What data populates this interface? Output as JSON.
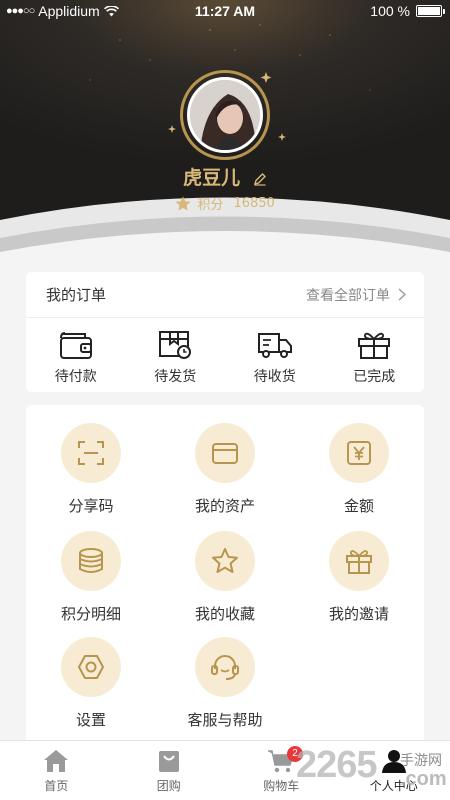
{
  "status_bar": {
    "carrier": "Applidium",
    "time": "11:27 AM",
    "battery": "100 %"
  },
  "profile": {
    "username": "虎豆儿",
    "points_label": "积分",
    "points_value": "16850"
  },
  "orders": {
    "title": "我的订单",
    "view_all": "查看全部订单",
    "items": [
      {
        "label": "待付款",
        "icon": "wallet-icon"
      },
      {
        "label": "待发货",
        "icon": "shipping-box-icon"
      },
      {
        "label": "待收货",
        "icon": "truck-icon"
      },
      {
        "label": "已完成",
        "icon": "gift-box-icon"
      }
    ]
  },
  "menu": {
    "items": [
      {
        "label": "分享码",
        "icon": "scan-code-icon"
      },
      {
        "label": "我的资产",
        "icon": "wallet-icon"
      },
      {
        "label": "金额",
        "icon": "yen-icon"
      },
      {
        "label": "积分明细",
        "icon": "coins-icon"
      },
      {
        "label": "我的收藏",
        "icon": "star-icon"
      },
      {
        "label": "我的邀请",
        "icon": "gift-icon"
      },
      {
        "label": "设置",
        "icon": "settings-icon"
      },
      {
        "label": "客服与帮助",
        "icon": "headset-icon"
      }
    ]
  },
  "tabbar": {
    "tabs": [
      {
        "label": "首页",
        "icon": "home-icon"
      },
      {
        "label": "团购",
        "icon": "bag-icon"
      },
      {
        "label": "购物车",
        "icon": "cart-icon",
        "badge": "2"
      },
      {
        "label": "个人中心",
        "icon": "user-icon"
      }
    ]
  },
  "watermark": {
    "number": "2265",
    "site": "手游网",
    "domain": ".com"
  },
  "colors": {
    "gold": "#d6b878",
    "icon_gold": "#b8954e",
    "circle_bg": "#f7ecd3",
    "badge": "#e9383a"
  }
}
